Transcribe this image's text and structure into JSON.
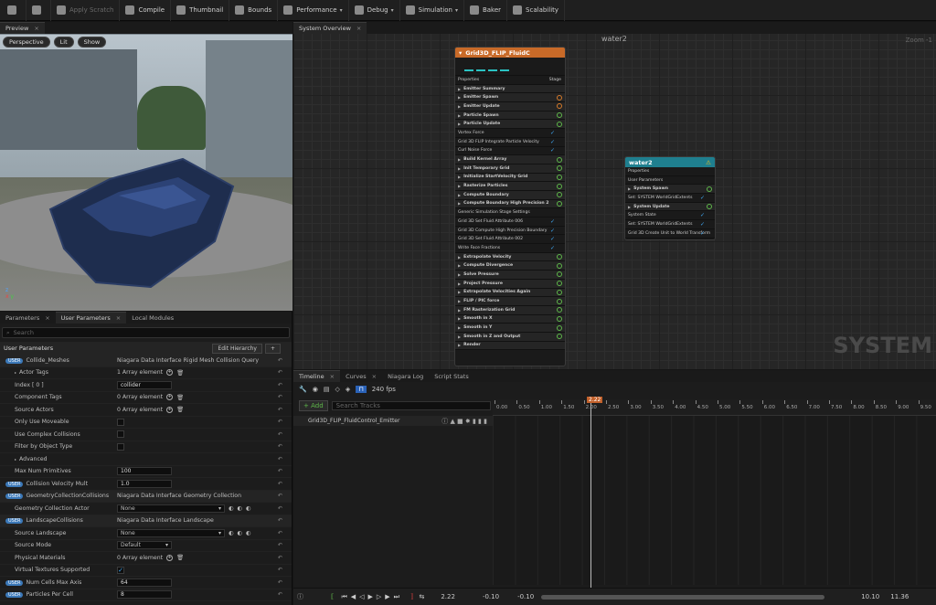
{
  "toolbar": {
    "items": [
      {
        "label": "",
        "icon": "save-icon",
        "disabled": false
      },
      {
        "label": "",
        "icon": "browse-icon",
        "disabled": false
      },
      {
        "label": "Apply Scratch",
        "icon": "apply-scratch-icon",
        "disabled": true
      },
      {
        "label": "Compile",
        "icon": "compile-icon",
        "disabled": false
      },
      {
        "label": "Thumbnail",
        "icon": "thumbnail-icon",
        "disabled": false
      },
      {
        "label": "Bounds",
        "icon": "bounds-icon",
        "disabled": false
      },
      {
        "label": "Performance",
        "icon": "performance-icon",
        "disabled": false,
        "dropdown": true
      },
      {
        "label": "Debug",
        "icon": "debug-icon",
        "disabled": false,
        "dropdown": true
      },
      {
        "label": "Simulation",
        "icon": "simulation-icon",
        "disabled": false,
        "dropdown": true
      },
      {
        "label": "Baker",
        "icon": "baker-icon",
        "disabled": false
      },
      {
        "label": "Scalability",
        "icon": "scalability-icon",
        "disabled": false
      }
    ]
  },
  "preview": {
    "tab_label": "Preview",
    "buttons": [
      "Perspective",
      "Lit",
      "Show"
    ]
  },
  "bottom_tabs": {
    "parameters": "Parameters",
    "user_parameters": "User Parameters",
    "local_modules": "Local Modules"
  },
  "params": {
    "search_placeholder": "Search",
    "section_title": "User Parameters",
    "edit_hierarchy": "Edit Hierarchy",
    "add_label": "+",
    "rows": [
      {
        "label": "Collide_Meshes",
        "badge": "USER",
        "value": "Niagara Data Interface Rigid Mesh Collision Query",
        "kind": "header"
      },
      {
        "label": "Actor Tags",
        "value": "1 Array element",
        "kind": "array"
      },
      {
        "label": "Index [ 0 ]",
        "value": "collider",
        "kind": "input"
      },
      {
        "label": "Component Tags",
        "value": "0 Array element",
        "kind": "array"
      },
      {
        "label": "Source Actors",
        "value": "0 Array element",
        "kind": "array"
      },
      {
        "label": "Only Use Moveable",
        "value": "",
        "kind": "check"
      },
      {
        "label": "Use Complex Collisions",
        "value": "",
        "kind": "check"
      },
      {
        "label": "Filter by Object Type",
        "value": "",
        "kind": "check"
      },
      {
        "label": "Advanced",
        "value": "",
        "kind": "group"
      },
      {
        "label": "Max Num Primitives",
        "value": "100",
        "kind": "input"
      },
      {
        "label": "Collision Velocity Mult",
        "badge": "USER",
        "value": "1.0",
        "kind": "input"
      },
      {
        "label": "GeometryCollectionCollisions",
        "badge": "USER",
        "value": "Niagara Data Interface Geometry Collection",
        "kind": "header"
      },
      {
        "label": "Geometry Collection Actor",
        "value": "None",
        "kind": "dropdown"
      },
      {
        "label": "LandscapeCollisions",
        "badge": "USER",
        "value": "Niagara Data Interface Landscape",
        "kind": "header"
      },
      {
        "label": "Source Landscape",
        "value": "None",
        "kind": "dropdown"
      },
      {
        "label": "Source Mode",
        "value": "Default",
        "kind": "select"
      },
      {
        "label": "Physical Materials",
        "value": "0 Array element",
        "kind": "array"
      },
      {
        "label": "Virtual Textures Supported",
        "value": "",
        "kind": "checkon"
      },
      {
        "label": "Num Cells Max Axis",
        "badge": "USER",
        "value": "64",
        "kind": "input"
      },
      {
        "label": "Particles Per Cell",
        "badge": "USER",
        "value": "8",
        "kind": "input"
      }
    ]
  },
  "graph": {
    "tab_label": "System Overview",
    "system_name": "water2",
    "zoom_label": "Zoom -1",
    "watermark": "SYSTEM",
    "emitter_node": {
      "title": "Grid3D_FLIP_FluidC",
      "properties": "Properties",
      "stage": "Stage",
      "rows": [
        {
          "t": "Emitter Summary",
          "g": true
        },
        {
          "t": "Emitter Spawn",
          "g": true,
          "pin": "o"
        },
        {
          "t": "Emitter Update",
          "g": true,
          "pin": "o"
        },
        {
          "t": "Particle Spawn",
          "g": true,
          "pin": "g"
        },
        {
          "t": "Particle Update",
          "g": true,
          "pin": "g"
        },
        {
          "t": "Vortex Force",
          "g": false,
          "ck": true
        },
        {
          "t": "Grid 3D FLIP Integrate Particle Velocity",
          "g": false,
          "ck": true
        },
        {
          "t": "Curl Noise Force",
          "g": false,
          "ck": true
        },
        {
          "t": "Build Kernel Array",
          "g": true,
          "pin": "g"
        },
        {
          "t": "Init Temporary Grid",
          "g": true,
          "pin": "g"
        },
        {
          "t": "Initialize StartVelocity Grid",
          "g": true,
          "pin": "g"
        },
        {
          "t": "Rasterize Particles",
          "g": true,
          "pin": "g"
        },
        {
          "t": "Compute Boundary",
          "g": true,
          "pin": "g"
        },
        {
          "t": "Compute Boundary High Precision 2",
          "g": true,
          "pin": "g"
        },
        {
          "t": "Generic Simulation Stage Settings",
          "g": false
        },
        {
          "t": "Grid 3D Set Fluid Attribute 006",
          "g": false,
          "ck": true
        },
        {
          "t": "Grid 3D Compute High Precision Boundary",
          "g": false,
          "ck": true
        },
        {
          "t": "Grid 3D Set Fluid Attribute 002",
          "g": false,
          "ck": true
        },
        {
          "t": "Write Face Fractions",
          "g": false,
          "ck": true
        },
        {
          "t": "Extrapolate Velocity",
          "g": true,
          "pin": "g"
        },
        {
          "t": "Compute Divergence",
          "g": true,
          "pin": "g"
        },
        {
          "t": "Solve Pressure",
          "g": true,
          "pin": "g"
        },
        {
          "t": "Project Pressure",
          "g": true,
          "pin": "g"
        },
        {
          "t": "Extrapolate Velocities Again",
          "g": true,
          "pin": "g"
        },
        {
          "t": "FLIP / PIC force",
          "g": true,
          "pin": "g"
        },
        {
          "t": "FM Rasterization Grid",
          "g": true,
          "pin": "g"
        },
        {
          "t": "Smooth in X",
          "g": true,
          "pin": "g"
        },
        {
          "t": "Smooth in Y",
          "g": true,
          "pin": "g"
        },
        {
          "t": "Smooth in Z and Output",
          "g": true,
          "pin": "g"
        },
        {
          "t": "Render",
          "g": true
        }
      ]
    },
    "system_node": {
      "title": "water2",
      "rows": [
        {
          "t": "Properties",
          "g": false
        },
        {
          "t": "User Parameters",
          "g": false
        },
        {
          "t": "System Spawn",
          "g": true,
          "pin": "g"
        },
        {
          "t": "Set: SYSTEM WorldGridExtents",
          "g": false,
          "ck": true
        },
        {
          "t": "System Update",
          "g": true,
          "pin": "g"
        },
        {
          "t": "System State",
          "g": false,
          "ck": true
        },
        {
          "t": "Set: SYSTEM WorldGridExtents",
          "g": false,
          "ck": true
        },
        {
          "t": "Grid 3D Create Unit to World Transform",
          "g": false,
          "ck": true
        }
      ]
    }
  },
  "timeline": {
    "tabs": [
      "Timeline",
      "Curves",
      "Niagara Log",
      "Script Stats"
    ],
    "add_label": "+ Add",
    "search_placeholder": "Search Tracks",
    "fps": "240 fps",
    "track_name": "Grid3D_FLIP_FluidControl_Emitter",
    "playhead": "2.22",
    "ticks": [
      "0.00",
      "0.50",
      "1.00",
      "1.50",
      "2.00",
      "2.50",
      "3.00",
      "3.50",
      "4.00",
      "4.50",
      "5.00",
      "5.50",
      "6.00",
      "6.50",
      "7.00",
      "7.50",
      "8.00",
      "8.50",
      "9.00",
      "9.50"
    ],
    "current_time": "2.22",
    "range_start_a": "-0.10",
    "range_start_b": "-0.10",
    "range_end_a": "10.10",
    "range_end_b": "11.36"
  }
}
